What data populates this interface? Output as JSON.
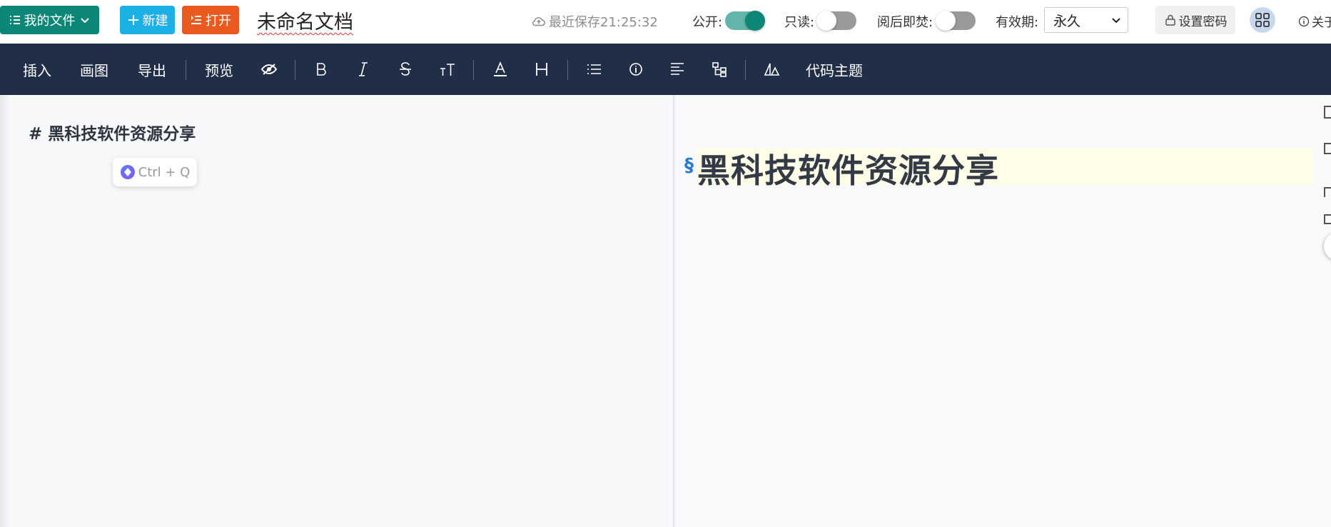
{
  "topbar": {
    "files_label": "我的文件",
    "new_label": "新建",
    "open_label": "打开",
    "doc_title": "未命名文档",
    "save_status": "最近保存21:25:32",
    "public_label": "公开:",
    "public_on": true,
    "readonly_label": "只读:",
    "readonly_on": false,
    "burn_label": "阅后即焚:",
    "burn_on": false,
    "validity_label": "有效期:",
    "validity_value": "永久",
    "set_password_label": "设置密码",
    "about_label": "关于"
  },
  "toolbar": {
    "insert": "插入",
    "draw": "画图",
    "export": "导出",
    "preview": "预览",
    "code_theme": "代码主题"
  },
  "editor": {
    "markdown_line": "# 黑科技软件资源分享",
    "shortcut_hint": "Ctrl + Q"
  },
  "preview": {
    "anchor": "§",
    "heading": "黑科技软件资源分享"
  },
  "colors": {
    "files_button": "#0c8677",
    "new_button": "#1bb0e6",
    "open_button": "#ea5a1e",
    "toolbar_bg": "#202e47",
    "heading_highlight": "#fdfde8"
  }
}
